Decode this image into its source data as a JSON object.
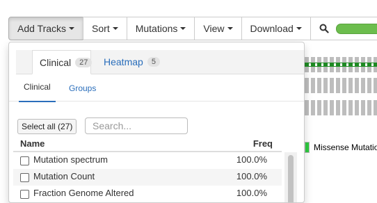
{
  "toolbar": {
    "add_tracks": "Add Tracks",
    "sort": "Sort",
    "mutations": "Mutations",
    "view": "View",
    "download": "Download",
    "zoom_icon": "search-icon"
  },
  "oncoprint": {
    "legend_label": "Missense Mutatio",
    "legend_color": "#2ecc40",
    "track_color": "#bdbdbd",
    "mutation_color": "#1e8a23"
  },
  "dropdown": {
    "tabs": [
      {
        "label": "Clinical",
        "count": "27",
        "active": true
      },
      {
        "label": "Heatmap",
        "count": "5",
        "active": false
      }
    ],
    "subtabs": [
      {
        "label": "Clinical",
        "active": true
      },
      {
        "label": "Groups",
        "active": false
      }
    ],
    "select_all_label": "Select all (27)",
    "search_placeholder": "Search...",
    "columns": {
      "name": "Name",
      "freq": "Freq"
    },
    "rows": [
      {
        "name": "Mutation spectrum",
        "freq": "100.0%"
      },
      {
        "name": "Mutation Count",
        "freq": "100.0%"
      },
      {
        "name": "Fraction Genome Altered",
        "freq": "100.0%"
      }
    ]
  },
  "colors": {
    "link": "#2a6ebb",
    "zoom_slider": "#6cbd4d"
  }
}
